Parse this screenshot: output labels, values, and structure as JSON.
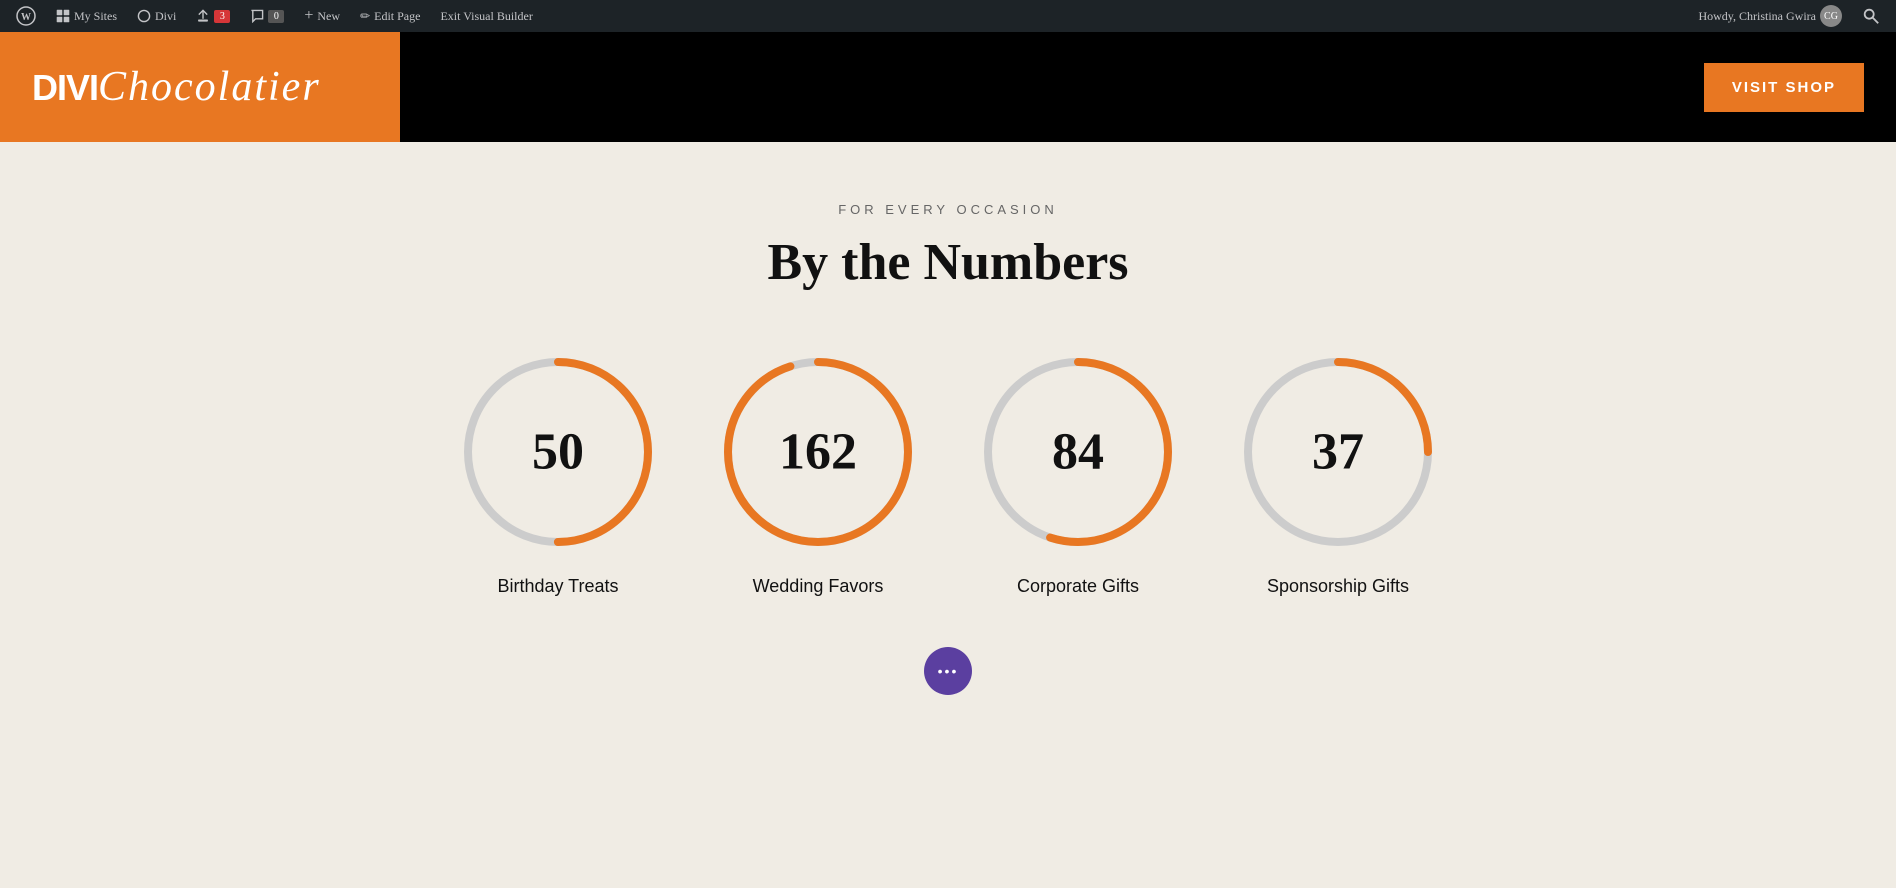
{
  "admin_bar": {
    "wp_logo": "⊕",
    "my_sites_label": "My Sites",
    "divi_label": "Divi",
    "updates_count": "3",
    "comments_count": "0",
    "new_label": "New",
    "edit_page_label": "Edit Page",
    "exit_builder_label": "Exit Visual Builder",
    "howdy_label": "Howdy, Christina Gwira",
    "user_name": "Christina Gwira"
  },
  "header": {
    "logo_bold": "DIVI",
    "logo_script": "Chocolatier",
    "visit_shop_label": "VISIT SHOP"
  },
  "main": {
    "eyebrow": "FOR EVERY OCCASION",
    "title": "By the Numbers",
    "stats": [
      {
        "value": "50",
        "label": "Birthday Treats",
        "percent": 50,
        "circumference": 565.49,
        "dash_offset": 282.75
      },
      {
        "value": "162",
        "label": "Wedding Favors",
        "percent": 95,
        "circumference": 565.49,
        "dash_offset": 28.27
      },
      {
        "value": "84",
        "label": "Corporate Gifts",
        "percent": 55,
        "circumference": 565.49,
        "dash_offset": 254.47
      },
      {
        "value": "37",
        "label": "Sponsorship Gifts",
        "percent": 25,
        "circumference": 565.49,
        "dash_offset": 424.12
      }
    ]
  },
  "fab": {
    "dots": "•••"
  }
}
